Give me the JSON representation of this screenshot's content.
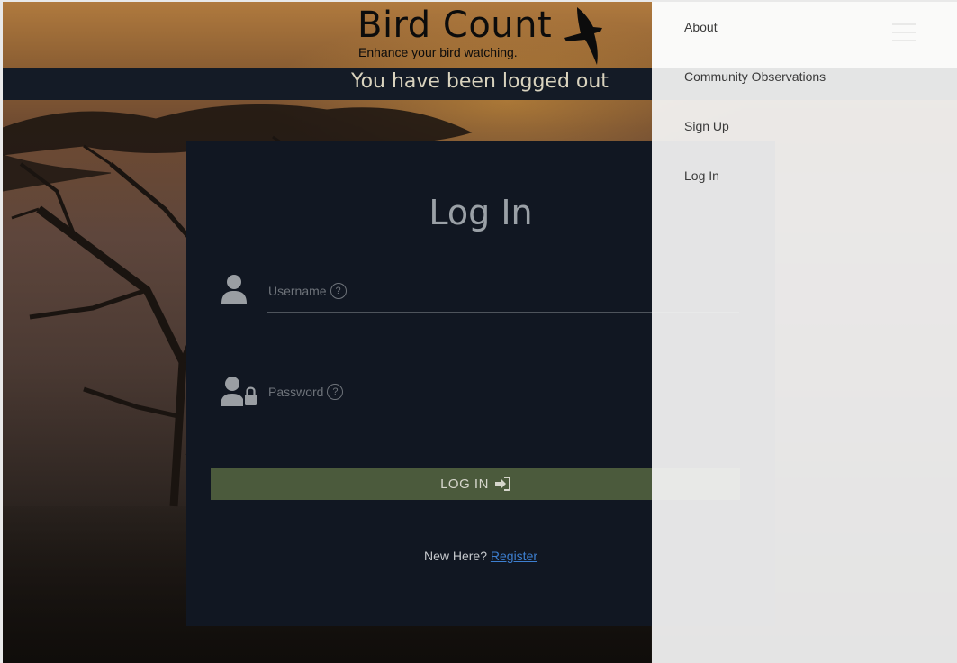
{
  "header": {
    "logo_title": "Bird Count",
    "logo_tagline": "Enhance your bird watching.",
    "logo_icon": "bird-silhouette-icon"
  },
  "status": {
    "message": "You have been logged out"
  },
  "login": {
    "title": "Log In",
    "username_label": "Username",
    "password_label": "Password",
    "help_glyph": "?",
    "submit_label": "LOG IN",
    "register_prompt": "New Here?",
    "register_link": "Register"
  },
  "menu": {
    "items": [
      {
        "label": "About"
      },
      {
        "label": "Community Observations"
      },
      {
        "label": "Sign Up"
      },
      {
        "label": "Log In"
      }
    ]
  },
  "colors": {
    "status_bar": "#141b26",
    "card_bg": "#111722",
    "button_bg": "#4b5a3c",
    "link": "#3d7fd0",
    "menu_bg": "#f4f4f4"
  }
}
